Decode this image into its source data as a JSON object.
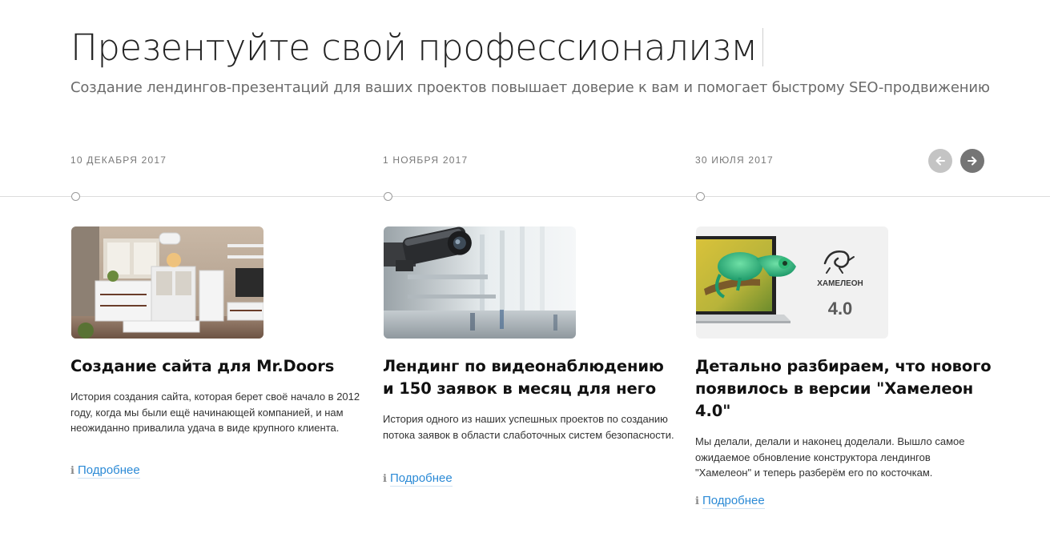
{
  "header": {
    "title": "Презентуйте свой профессионализм",
    "subtitle": "Создание лендингов-презентаций для ваших проектов повышает доверие к вам и помогает быстрому SEO-продвижению"
  },
  "nav": {
    "prev_icon": "arrow-left-icon",
    "next_icon": "arrow-right-icon"
  },
  "colors": {
    "link": "#2b8ad6",
    "nav_prev": "#c4c4c4",
    "nav_next": "#757575"
  },
  "cards": [
    {
      "date": "10 декабря 2017",
      "title": "Создание сайта для Mr.Doors",
      "text": "История создания сайта, которая берет своё начало в 2012 году, когда мы были ещё начинающей компанией, и нам неожиданно привалила удача в виде крупного клиента.",
      "more_label": "Подробнее",
      "image": "furniture-interior-photo"
    },
    {
      "date": "1 ноября 2017",
      "title": "Лендинг по видеонаблюдению и 150 заявок в месяц для него",
      "text": "История одного из наших успешных проектов по созданию потока заявок в области слаботочных систем безопасности.",
      "more_label": "Подробнее",
      "image": "security-camera-photo"
    },
    {
      "date": "30 июля 2017",
      "title": "Детально разбираем, что нового появилось в версии \"Хамелеон 4.0\"",
      "text": "Мы делали, делали и наконец доделали. Вышло самое ожидаемое обновление конструктора лендингов \"Хамелеон\" и теперь разберём его по косточкам.",
      "more_label": "Подробнее",
      "image": "chameleon-laptop-image",
      "image_brand": "ХАМЕЛЕОН",
      "image_version": "4.0"
    }
  ]
}
